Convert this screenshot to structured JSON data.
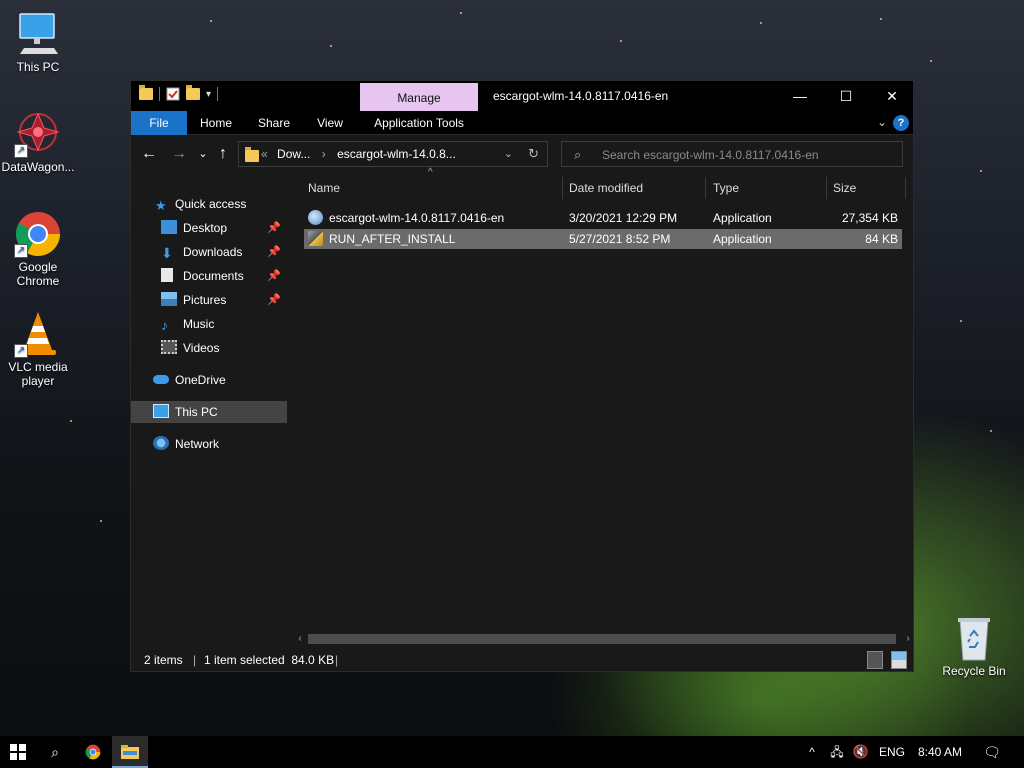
{
  "desktop": {
    "icons": [
      {
        "label": "This PC",
        "icon": "computer-icon"
      },
      {
        "label": "DataWagon...",
        "icon": "datawagon-icon"
      },
      {
        "label": "Google Chrome",
        "icon": "chrome-icon"
      },
      {
        "label": "VLC media player",
        "icon": "vlc-icon"
      },
      {
        "label": "Recycle Bin",
        "icon": "recycle-bin-icon"
      }
    ]
  },
  "window": {
    "title": "escargot-wlm-14.0.8117.0416-en",
    "manage_tab": "Manage",
    "controls": {
      "minimize": "—",
      "maximize": "☐",
      "close": "✕"
    },
    "ribbon_tabs": [
      "File",
      "Home",
      "Share",
      "View",
      "Application Tools"
    ],
    "address": {
      "prefix": "«",
      "segments": [
        "Dow...",
        "escargot-wlm-14.0.8..."
      ],
      "separator": "›"
    },
    "search_placeholder": "Search escargot-wlm-14.0.8117.0416-en",
    "nav_pane": {
      "quick_access": "Quick access",
      "quick_items": [
        {
          "label": "Desktop",
          "pinned": true
        },
        {
          "label": "Downloads",
          "pinned": true
        },
        {
          "label": "Documents",
          "pinned": true
        },
        {
          "label": "Pictures",
          "pinned": true
        },
        {
          "label": "Music",
          "pinned": false
        },
        {
          "label": "Videos",
          "pinned": false
        }
      ],
      "onedrive": "OneDrive",
      "this_pc": "This PC",
      "network": "Network"
    },
    "columns": [
      "Name",
      "Date modified",
      "Type",
      "Size"
    ],
    "files": [
      {
        "name": "escargot-wlm-14.0.8117.0416-en",
        "date": "3/20/2021 12:29 PM",
        "type": "Application",
        "size": "27,354 KB",
        "selected": false
      },
      {
        "name": "RUN_AFTER_INSTALL",
        "date": "5/27/2021 8:52 PM",
        "type": "Application",
        "size": "84 KB",
        "selected": true
      }
    ],
    "status": {
      "items": "2 items",
      "selection": "1 item selected  84.0 KB"
    }
  },
  "taskbar": {
    "language": "ENG",
    "time": "8:40 AM"
  },
  "colors": {
    "accent": "#1a73c8",
    "manage_tab": "#e6c5f0",
    "window_bg": "#191919",
    "selection": "#6b6b6b"
  }
}
